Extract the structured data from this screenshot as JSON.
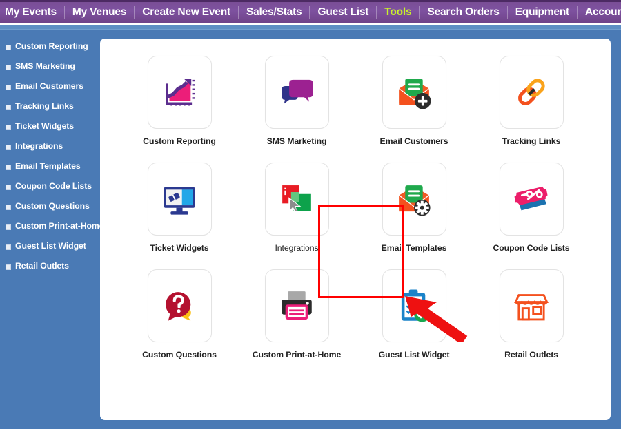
{
  "topnav": {
    "items": [
      {
        "label": "My Events",
        "active": false
      },
      {
        "label": "My Venues",
        "active": false
      },
      {
        "label": "Create New Event",
        "active": false
      },
      {
        "label": "Sales/Stats",
        "active": false
      },
      {
        "label": "Guest List",
        "active": false
      },
      {
        "label": "Tools",
        "active": true
      },
      {
        "label": "Search Orders",
        "active": false
      },
      {
        "label": "Equipment",
        "active": false
      },
      {
        "label": "Accounting",
        "active": false
      }
    ],
    "active_color": "#c8f02a",
    "background_color": "#7a4e96"
  },
  "sidebar": {
    "items": [
      {
        "label": "Custom Reporting"
      },
      {
        "label": "SMS Marketing"
      },
      {
        "label": "Email Customers"
      },
      {
        "label": "Tracking Links"
      },
      {
        "label": "Ticket Widgets"
      },
      {
        "label": "Integrations"
      },
      {
        "label": "Email Templates"
      },
      {
        "label": "Coupon Code Lists"
      },
      {
        "label": "Custom Questions"
      },
      {
        "label": "Custom Print-at-Home"
      },
      {
        "label": "Guest List Widget"
      },
      {
        "label": "Retail Outlets"
      }
    ],
    "background_color": "#4a7ab5"
  },
  "main": {
    "tiles": [
      {
        "label": "Custom Reporting",
        "icon": "chart-growth-icon",
        "highlighted": false
      },
      {
        "label": "SMS Marketing",
        "icon": "speech-bubbles-icon",
        "highlighted": false
      },
      {
        "label": "Email Customers",
        "icon": "envelope-plus-icon",
        "highlighted": false
      },
      {
        "label": "Tracking Links",
        "icon": "chain-link-icon",
        "highlighted": false
      },
      {
        "label": "Ticket Widgets",
        "icon": "monitor-ticket-icon",
        "highlighted": false
      },
      {
        "label": "Integrations",
        "icon": "overlapping-windows-cursor-icon",
        "highlighted": true
      },
      {
        "label": "Email Templates",
        "icon": "envelope-gear-icon",
        "highlighted": false
      },
      {
        "label": "Coupon Code Lists",
        "icon": "percent-coupon-icon",
        "highlighted": false
      },
      {
        "label": "Custom Questions",
        "icon": "question-bubble-icon",
        "highlighted": false
      },
      {
        "label": "Custom Print-at-Home",
        "icon": "printer-icon",
        "highlighted": false
      },
      {
        "label": "Guest List Widget",
        "icon": "clipboard-check-icon",
        "highlighted": false
      },
      {
        "label": "Retail Outlets",
        "icon": "storefront-icon",
        "highlighted": false
      }
    ]
  },
  "annotations": {
    "highlight_color": "#ff0000",
    "arrow_color": "#ee1111",
    "highlight_target": "Integrations",
    "arrow_target": "Integrations"
  }
}
